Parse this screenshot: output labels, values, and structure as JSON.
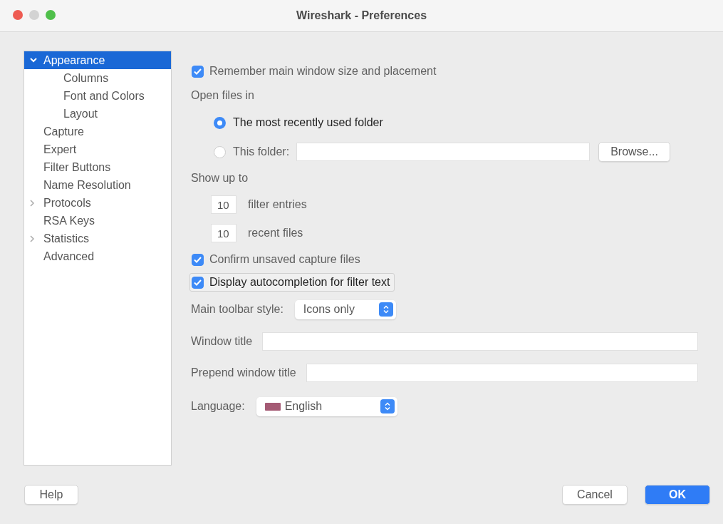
{
  "window": {
    "title": "Wireshark - Preferences"
  },
  "sidebar": {
    "items": [
      {
        "label": "Appearance",
        "selected": true,
        "expanded": true,
        "children": [
          {
            "label": "Columns",
            "selected": false
          },
          {
            "label": "Font and Colors",
            "selected": false
          },
          {
            "label": "Layout",
            "selected": false
          }
        ]
      },
      {
        "label": "Capture",
        "selected": false
      },
      {
        "label": "Expert",
        "selected": false
      },
      {
        "label": "Filter Buttons",
        "selected": false
      },
      {
        "label": "Name Resolution",
        "selected": false
      },
      {
        "label": "Protocols",
        "selected": false,
        "expanded": false
      },
      {
        "label": "RSA Keys",
        "selected": false
      },
      {
        "label": "Statistics",
        "selected": false,
        "expanded": false
      },
      {
        "label": "Advanced",
        "selected": false
      }
    ]
  },
  "settings": [
    {
      "kind": "checkbox",
      "label": "Remember main window size and placement",
      "checked": true,
      "focused": false
    },
    {
      "kind": "heading",
      "label": "Open files in"
    },
    {
      "kind": "radio",
      "label": "The most recently used folder",
      "selected": true
    },
    {
      "kind": "folder",
      "label": "This folder:",
      "selected": false,
      "button": "Browse..."
    },
    {
      "kind": "heading",
      "label": "Show up to"
    },
    {
      "kind": "number",
      "value": "10",
      "label": "filter entries"
    },
    {
      "kind": "number",
      "value": "10",
      "label": "recent files"
    },
    {
      "kind": "checkbox",
      "label": "Confirm unsaved capture files",
      "checked": true,
      "focused": false
    },
    {
      "kind": "checkbox",
      "label": "Display autocompletion for filter text",
      "checked": true,
      "focused": true
    },
    {
      "kind": "dropdown",
      "label": "Main toolbar style:",
      "value": "Icons only",
      "flag": false
    },
    {
      "kind": "text",
      "label": "Window title"
    },
    {
      "kind": "text",
      "label": "Prepend window title"
    },
    {
      "kind": "dropdown",
      "label": "Language:",
      "value": "English",
      "flag": true
    }
  ],
  "footer": {
    "left_buttons": [
      {
        "label": "Help",
        "default": false
      }
    ],
    "right_buttons": [
      {
        "label": "Cancel",
        "default": false
      },
      {
        "label": "OK",
        "default": true
      }
    ]
  }
}
